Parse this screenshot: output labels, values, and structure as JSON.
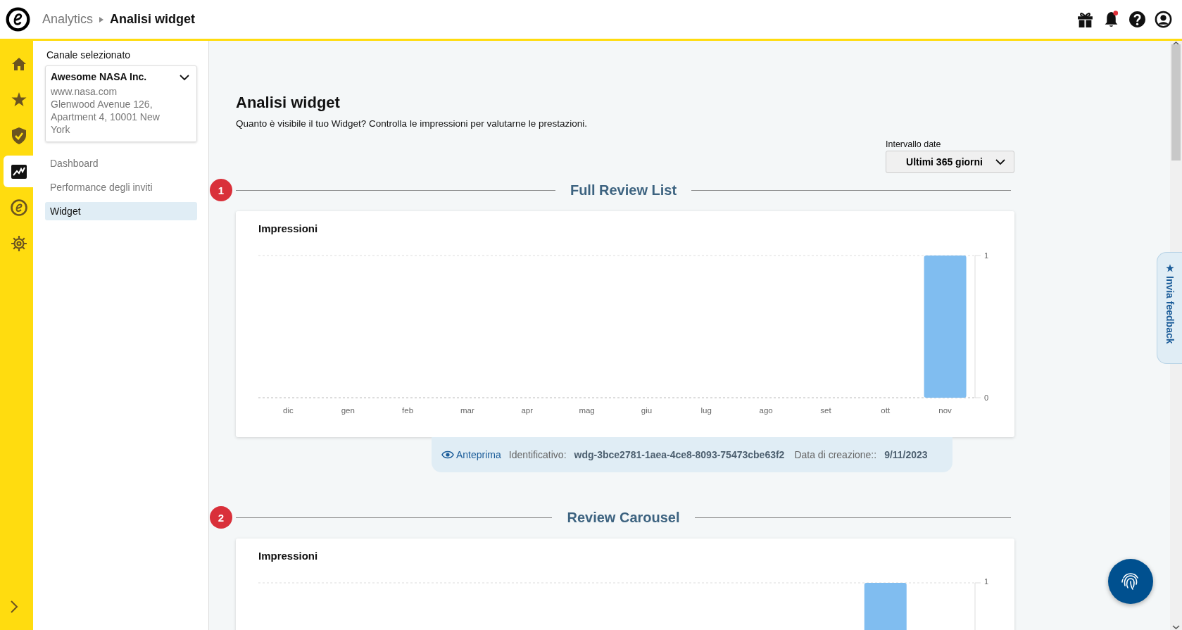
{
  "header": {
    "breadcrumb": [
      {
        "label": "Analytics"
      },
      {
        "label": "Analisi widget"
      }
    ]
  },
  "rail": [
    {
      "kind": "home",
      "selected": false
    },
    {
      "kind": "star",
      "selected": false
    },
    {
      "kind": "shield",
      "selected": false
    },
    {
      "kind": "analytics",
      "selected": true
    },
    {
      "kind": "logo",
      "selected": false
    },
    {
      "kind": "gear",
      "selected": false
    }
  ],
  "sidebar": {
    "heading": "Canale selezionato",
    "channel": {
      "name": "Awesome NASA Inc.",
      "url": "www.nasa.com",
      "address": "Glenwood Avenue 126, Apartment 4, 10001 New York"
    },
    "items": [
      {
        "label": "Dashboard",
        "selected": false
      },
      {
        "label": "Performance degli inviti",
        "selected": false
      },
      {
        "label": "Widget",
        "selected": true
      }
    ]
  },
  "page": {
    "title": "Analisi widget",
    "subtitle": "Quanto è visibile il tuo Widget? Controlla le impressioni per valutarne le prestazioni.",
    "date_range": {
      "label": "Intervallo date",
      "value": "Ultimi 365 giorni"
    }
  },
  "widgets": [
    {
      "number": "1",
      "name": "Full Review List",
      "chart": {
        "title": "Impressioni",
        "chart_data": {
          "type": "bar",
          "categories": [
            "dic",
            "gen",
            "feb",
            "mar",
            "apr",
            "mag",
            "giu",
            "lug",
            "ago",
            "set",
            "ott",
            "nov"
          ],
          "series": [
            {
              "color": "#80bdf0",
              "values": [
                0,
                0,
                0,
                0,
                0,
                0,
                0,
                0,
                0,
                0,
                0,
                1
              ]
            }
          ],
          "ylim": [
            0,
            1
          ],
          "yticks": [
            0,
            1
          ]
        }
      },
      "info": {
        "preview": "Anteprima",
        "id_label": "Identificativo:",
        "id": "wdg-3bce2781-1aea-4ce8-8093-75473cbe63f2",
        "date_label": "Data di creazione::",
        "date": "9/11/2023"
      }
    },
    {
      "number": "2",
      "name": "Review Carousel",
      "chart": {
        "title": "Impressioni",
        "top_tick": "1"
      }
    }
  ],
  "feedback": {
    "label": "Invia feedback"
  }
}
